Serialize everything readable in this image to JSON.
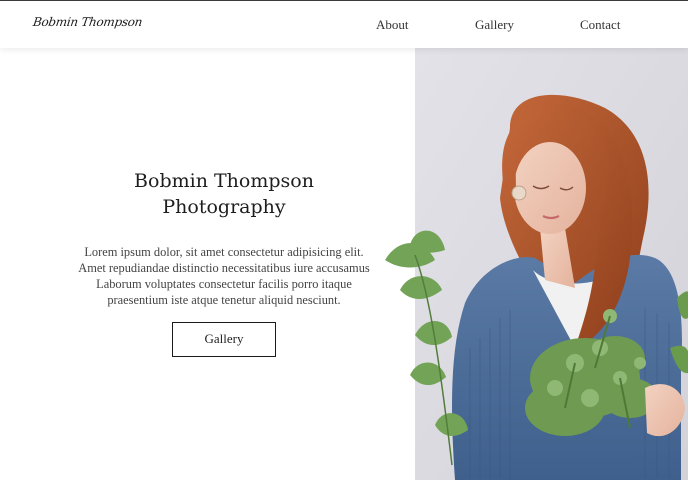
{
  "header": {
    "logo": "Bobmin Thompson",
    "nav": [
      "About",
      "Gallery",
      "Contact"
    ]
  },
  "hero": {
    "title_line1": "Bobmin Thompson",
    "title_line2": "Photography",
    "body": "Lorem ipsum dolor, sit amet consectetur adipisicing elit. Amet repudiandae distinctio necessitatibus iure accusamus Laborum voluptates consectetur facilis porro itaque praesentium iste atque tenetur aliquid nesciunt.",
    "button_label": "Gallery"
  },
  "photo": {
    "subject": "woman-with-red-hair-holding-greenery",
    "colors": {
      "background": "#dcdde2",
      "hair": "#b55a2c",
      "sweater": "#4f6f9a",
      "plant": "#5f8a45"
    }
  }
}
